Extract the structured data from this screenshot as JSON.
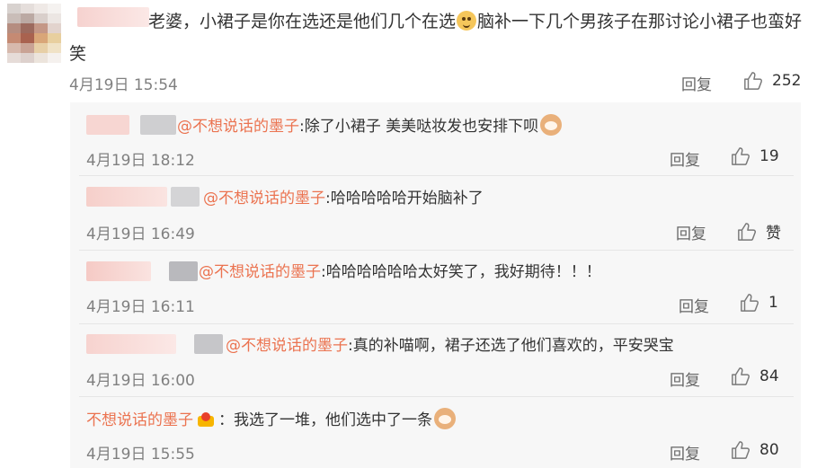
{
  "main_comment": {
    "text_a": "老婆，小裙子是你在选还是他们几个在选",
    "text_b": "脑补一下几个男孩子在那讨论小裙子也蛮好",
    "text_c": "笑",
    "date": "4月19日 15:54",
    "reply_label": "回复",
    "like_count": "252"
  },
  "replies": [
    {
      "mention": "@不想说话的墨子",
      "text": ":除了小裙子 美美哒妆发也安排下呗",
      "date": "4月19日 18:12",
      "reply_label": "回复",
      "like_count": "19"
    },
    {
      "mention": "@不想说话的墨子",
      "text": ":哈哈哈哈哈开始脑补了",
      "date": "4月19日 16:49",
      "reply_label": "回复",
      "like_count": "赞"
    },
    {
      "mention": "@不想说话的墨子",
      "text": ":哈哈哈哈哈哈太好笑了，我好期待！！！",
      "date": "4月19日 16:11",
      "reply_label": "回复",
      "like_count": "1"
    },
    {
      "mention": "@不想说话的墨子",
      "text": ":真的补喵啊，裙子还选了他们喜欢的，平安哭宝",
      "date": "4月19日 16:00",
      "reply_label": "回复",
      "like_count": "84"
    },
    {
      "mention": "不想说话的墨子",
      "text": "：我选了一堆，他们选中了一条",
      "date": "4月19日 15:55",
      "reply_label": "回复",
      "like_count": "80"
    }
  ],
  "colors": {
    "mention": "#eb7350",
    "date": "#808080",
    "sub_bg": "#f7f7f7"
  },
  "icons": {
    "like": "thumbs-up-icon",
    "emoji_cat": "cat-emoji-icon",
    "emoji_doge": "doge-emoji-icon",
    "crown": "crown-badge-icon"
  }
}
